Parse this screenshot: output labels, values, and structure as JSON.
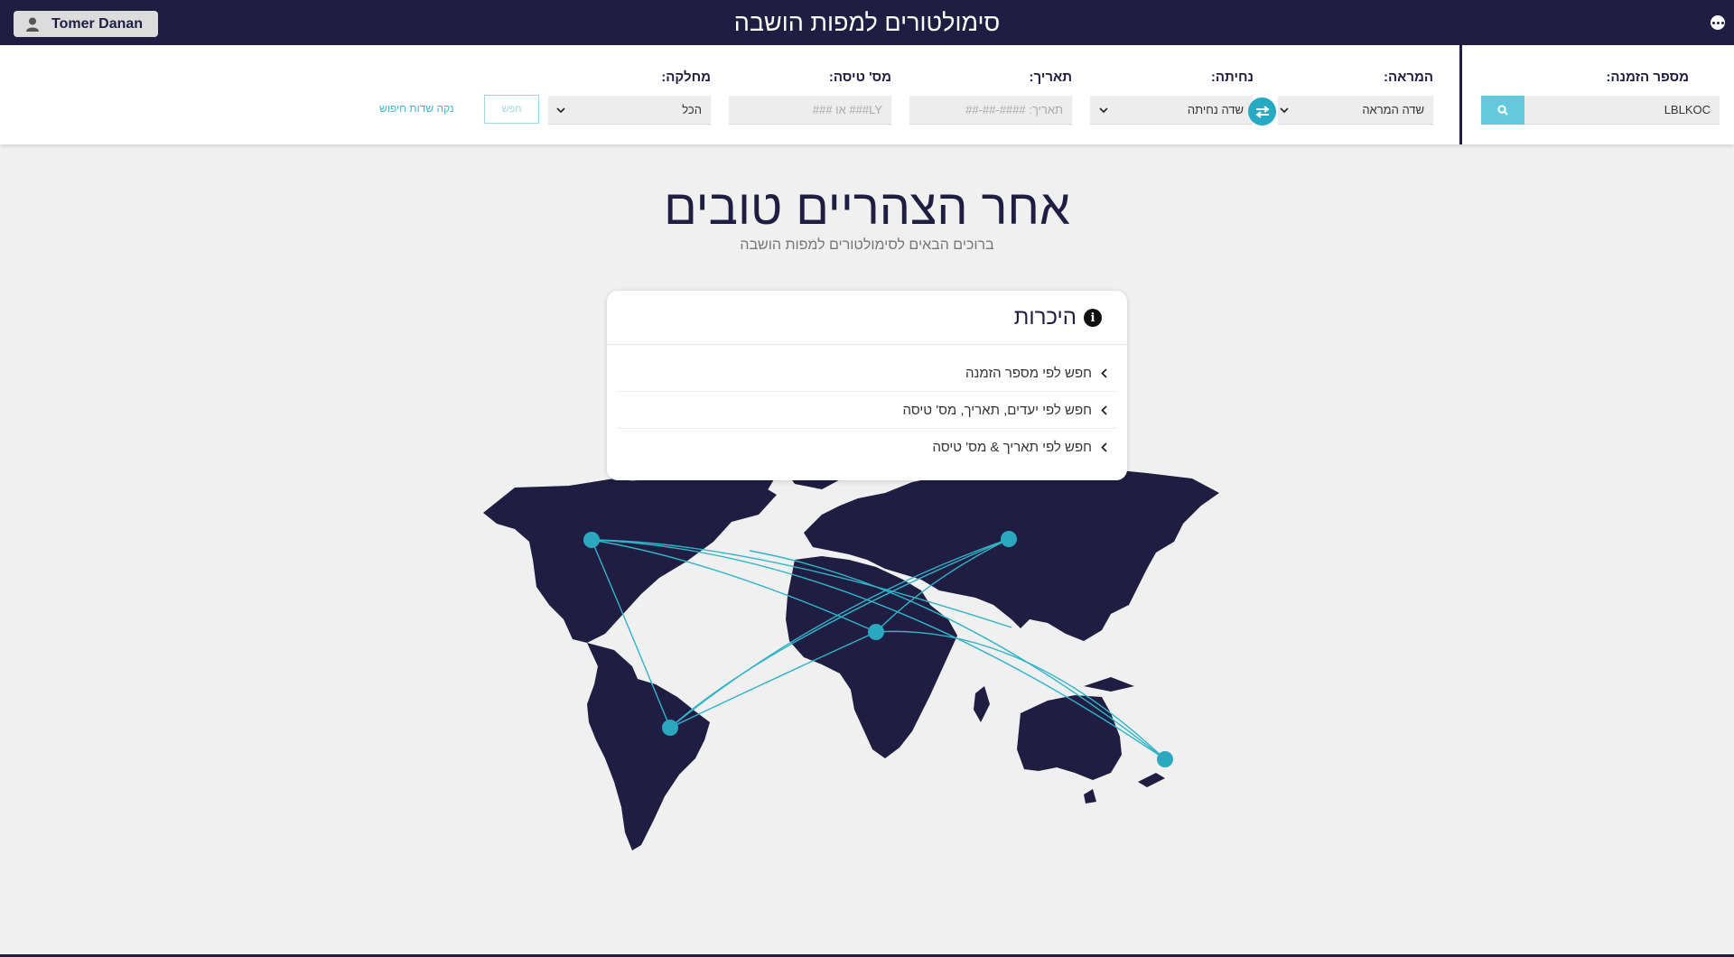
{
  "header": {
    "title": "סימולטורים למפות הושבה",
    "user_name": "Tomer Danan"
  },
  "search": {
    "booking_label": "מספר הזמנה:",
    "booking_value": "LBLKOC",
    "departure_label": "המראה:",
    "departure_value": "שדה המראה",
    "arrival_label": "נחיתה:",
    "arrival_value": "שדה נחיתה",
    "date_label": "תאריך:",
    "date_placeholder": "תאריך: ####-##-##",
    "flight_label": "מס' טיסה:",
    "flight_placeholder": "LY### או ###",
    "class_label": "מחלקה:",
    "class_value": "הכל",
    "search_button": "חפש",
    "clear_link": "נקה שדות חיפוש"
  },
  "hero": {
    "title": "אחר הצהריים טובים",
    "subtitle": "ברוכים הבאים לסימולטורים למפות הושבה"
  },
  "intro_card": {
    "title": "היכרות",
    "items": [
      {
        "label": "חפש לפי מספר הזמנה"
      },
      {
        "label": "חפש לפי יעדים, תאריך, מס' טיסה"
      },
      {
        "label": "חפש לפי תאריך & מס' טיסה"
      }
    ]
  },
  "colors": {
    "navy": "#1f1d42",
    "accent": "#26a9c2"
  },
  "icons": [
    "user-icon",
    "more-icon",
    "search-icon",
    "swap-icon",
    "chevron-down-icon",
    "info-icon",
    "chevron-left-icon"
  ]
}
